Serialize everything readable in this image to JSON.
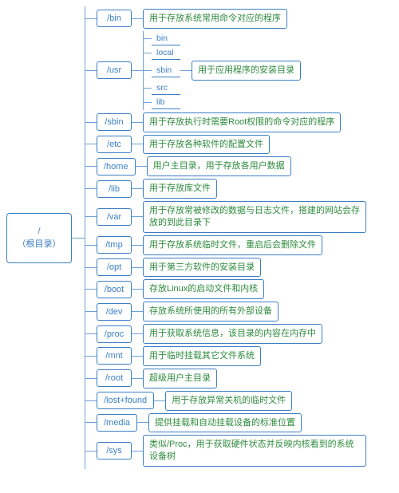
{
  "root": {
    "line1": "/",
    "line2": "（根目录）"
  },
  "usr": {
    "label": "/usr",
    "subs": [
      "bin",
      "local",
      "sbin",
      "src",
      "lib"
    ],
    "desc": "用于应用程序的安装目录"
  },
  "items": [
    {
      "label": "/bin",
      "desc": "用于存放系统常用命令对应的程序"
    },
    {
      "label": "/sbin",
      "desc": "用于存放执行时需要Root权限的命令对应的程序"
    },
    {
      "label": "/etc",
      "desc": "用于存放各种软件的配置文件"
    },
    {
      "label": "/home",
      "desc": "用户主目录，用于存放各用户数据"
    },
    {
      "label": "/lib",
      "desc": "用于存放库文件"
    },
    {
      "label": "/var",
      "desc": "用于存放常被修改的数据与日志文件，搭建的网站会存放的到此目录下"
    },
    {
      "label": "/tmp",
      "desc": "用于存放系统临时文件，重启后会删除文件"
    },
    {
      "label": "/opt",
      "desc": "用于第三方软件的安装目录"
    },
    {
      "label": "/boot",
      "desc": "存放Linux的启动文件和内核"
    },
    {
      "label": "/dev",
      "desc": "存放系统所使用的所有外部设备"
    },
    {
      "label": "/proc",
      "desc": "用于获取系统信息，该目录的内容在内存中"
    },
    {
      "label": "/mnt",
      "desc": "用于临时挂载其它文件系统"
    },
    {
      "label": "/root",
      "desc": "超级用户主目录"
    },
    {
      "label": "/lost+found",
      "desc": "用于存放异常关机的临时文件"
    },
    {
      "label": "/media",
      "desc": "提供挂载和自动挂载设备的标准位置"
    },
    {
      "label": "/sys",
      "desc": "类似/Proc，用于获取硬件状态并反映内核看到的系统设备树"
    }
  ]
}
